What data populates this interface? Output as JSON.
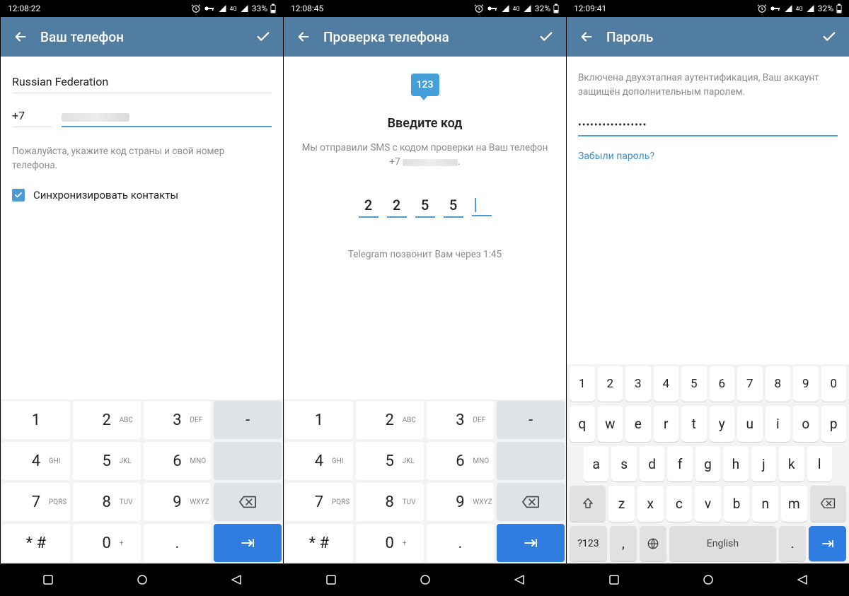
{
  "status": {
    "times": [
      "12:08:22",
      "12:08:45",
      "12:09:41"
    ],
    "battery": [
      "33%",
      "32%",
      "32%"
    ],
    "net_label": "4G"
  },
  "screen1": {
    "title": "Ваш телефон",
    "country": "Russian Federation",
    "code": "+7",
    "hint": "Пожалуйста, укажите код страны и свой номер телефона.",
    "sync_label": "Синхронизировать контакты"
  },
  "screen2": {
    "title": "Проверка телефона",
    "icon_text": "123",
    "code_heading": "Введите код",
    "desc_line1": "Мы отправили SMS с кодом проверки на Ваш телефон",
    "desc_prefix": "+7",
    "digits": [
      "2",
      "2",
      "5",
      "5"
    ],
    "call_hint": "Telegram позвонит Вам через 1:45"
  },
  "screen3": {
    "title": "Пароль",
    "desc": "Включена двухэтапная аутентификация, Ваш аккаунт защищён дополнительным паролем.",
    "password_mask": "•••••••••••••••••",
    "forgot": "Забыли пароль?"
  },
  "keypad": {
    "rows": [
      [
        {
          "d": "1",
          "l": ""
        },
        {
          "d": "2",
          "l": "ABC"
        },
        {
          "d": "3",
          "l": "DEF"
        },
        {
          "d": "-",
          "l": ""
        }
      ],
      [
        {
          "d": "4",
          "l": "GHI"
        },
        {
          "d": "5",
          "l": "JKL"
        },
        {
          "d": "6",
          "l": "MNO"
        },
        {
          "d": " ",
          "l": ""
        }
      ],
      [
        {
          "d": "7",
          "l": "PQRS"
        },
        {
          "d": "8",
          "l": "TUV"
        },
        {
          "d": "9",
          "l": "WXYZ"
        },
        {
          "d": "BKSP",
          "l": ""
        }
      ],
      [
        {
          "d": "* #",
          "l": ""
        },
        {
          "d": "0",
          "l": "+"
        },
        {
          "d": ".",
          "l": ""
        },
        {
          "d": "ENTER",
          "l": ""
        }
      ]
    ]
  },
  "qwerty": {
    "nums": [
      "1",
      "2",
      "3",
      "4",
      "5",
      "6",
      "7",
      "8",
      "9",
      "0"
    ],
    "row1": [
      "q",
      "w",
      "e",
      "r",
      "t",
      "y",
      "u",
      "i",
      "o",
      "p"
    ],
    "row2": [
      "a",
      "s",
      "d",
      "f",
      "g",
      "h",
      "j",
      "k",
      "l"
    ],
    "row3": [
      "z",
      "x",
      "c",
      "v",
      "b",
      "n",
      "m"
    ],
    "sym": "?123",
    "space": "English",
    "comma": ",",
    "dot": "."
  }
}
